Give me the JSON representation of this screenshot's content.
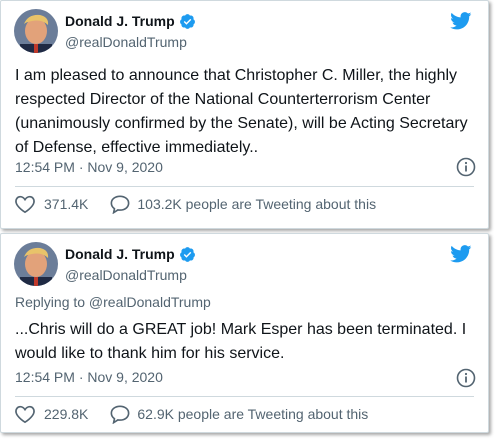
{
  "colors": {
    "twitter_blue": "#1d9bf0",
    "text": "#0f1419",
    "muted": "#536471"
  },
  "tweets": [
    {
      "name": "Donald J. Trump",
      "handle": "@realDonaldTrump",
      "verified_icon": "verified-badge-icon",
      "text": "I am pleased to announce that Christopher C. Miller, the highly respected Director of the National Counterterrorism Center (unanimously confirmed by the Senate), will be Acting Secretary of Defense, effective immediately..",
      "timestamp": "12:54 PM · Nov 9, 2020",
      "likes": "371.4K",
      "talk": "103.2K people are Tweeting about this"
    },
    {
      "name": "Donald J. Trump",
      "handle": "@realDonaldTrump",
      "verified_icon": "verified-badge-icon",
      "reply_to": "Replying to @realDonaldTrump",
      "text": "...Chris will do a GREAT job! Mark Esper has been terminated. I would like to thank him for his service.",
      "timestamp": "12:54 PM · Nov 9, 2020",
      "likes": "229.8K",
      "talk": "62.9K people are Tweeting about this"
    }
  ]
}
